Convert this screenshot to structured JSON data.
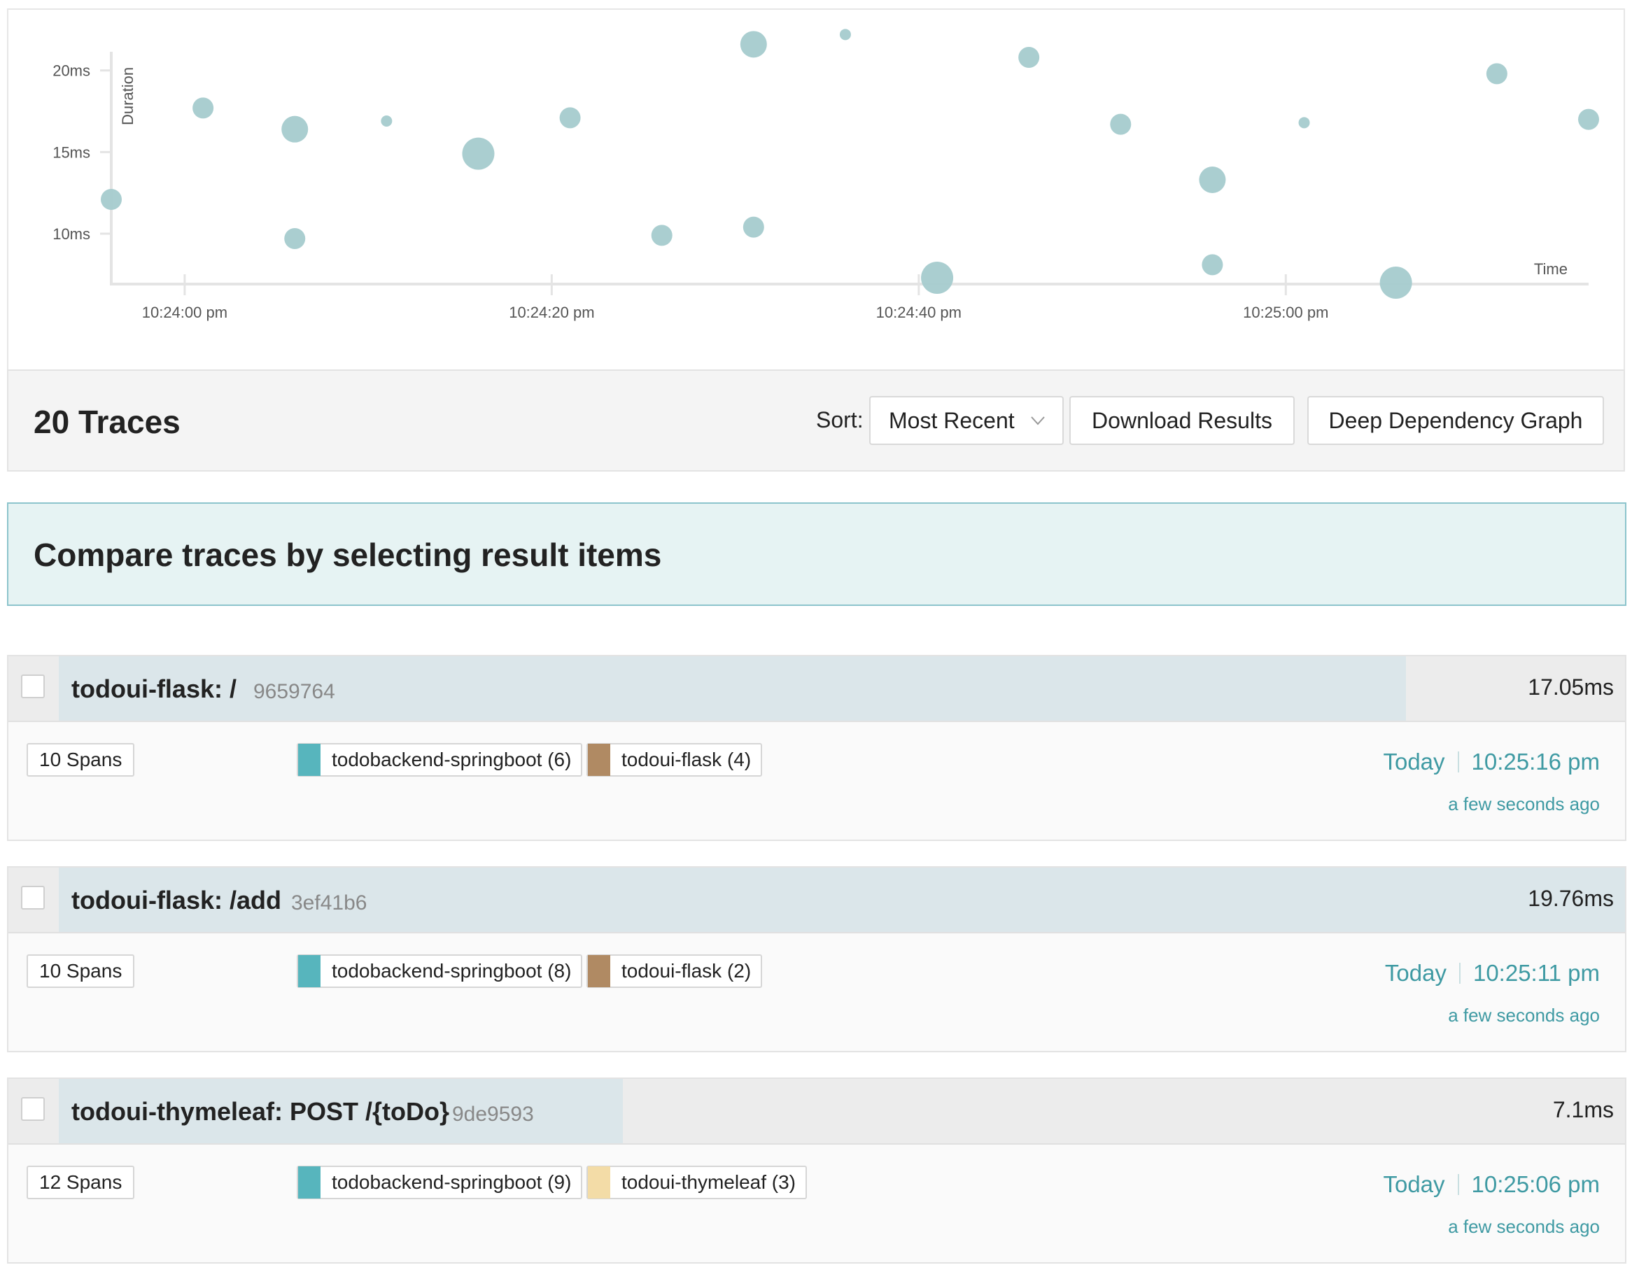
{
  "chart_data": {
    "type": "scatter",
    "xlabel": "Time",
    "ylabel": "Duration",
    "x_tick_labels": [
      "10:24:00 pm",
      "10:24:20 pm",
      "10:24:40 pm",
      "10:25:00 pm"
    ],
    "x_ticks_seconds": [
      0,
      20,
      40,
      60
    ],
    "y_tick_labels": [
      "10ms",
      "15ms",
      "20ms"
    ],
    "y_ticks_ms": [
      10,
      15,
      20
    ],
    "xlim_seconds": [
      -4,
      76.5
    ],
    "ylim_ms": [
      7,
      22
    ],
    "bubble_color": "#a5cbcd",
    "points": [
      {
        "t": -4.0,
        "ms": 12.1,
        "size": 2
      },
      {
        "t": 1.0,
        "ms": 17.7,
        "size": 2
      },
      {
        "t": 6.0,
        "ms": 16.4,
        "size": 3
      },
      {
        "t": 6.0,
        "ms": 9.7,
        "size": 2
      },
      {
        "t": 11.0,
        "ms": 16.9,
        "size": 1
      },
      {
        "t": 16.0,
        "ms": 14.9,
        "size": 4
      },
      {
        "t": 21.0,
        "ms": 17.1,
        "size": 2
      },
      {
        "t": 26.0,
        "ms": 9.9,
        "size": 2
      },
      {
        "t": 31.0,
        "ms": 21.6,
        "size": 3
      },
      {
        "t": 31.0,
        "ms": 10.4,
        "size": 2
      },
      {
        "t": 36.0,
        "ms": 22.2,
        "size": 1
      },
      {
        "t": 41.0,
        "ms": 7.3,
        "size": 4
      },
      {
        "t": 46.0,
        "ms": 20.8,
        "size": 2
      },
      {
        "t": 51.0,
        "ms": 16.7,
        "size": 2
      },
      {
        "t": 56.0,
        "ms": 13.3,
        "size": 3
      },
      {
        "t": 56.0,
        "ms": 8.1,
        "size": 2
      },
      {
        "t": 61.0,
        "ms": 16.8,
        "size": 1
      },
      {
        "t": 66.0,
        "ms": 7.0,
        "size": 4
      },
      {
        "t": 71.5,
        "ms": 19.8,
        "size": 2
      },
      {
        "t": 76.5,
        "ms": 17.0,
        "size": 2
      }
    ]
  },
  "results": {
    "count_label": "20 Traces",
    "sort_label": "Sort:",
    "sort_value": "Most Recent",
    "download_label": "Download Results",
    "ddg_label": "Deep Dependency Graph"
  },
  "compare": {
    "text": "Compare traces by selecting result items"
  },
  "traces": [
    {
      "title": "todoui-flask: /",
      "trace_id": "9659764",
      "duration": "17.05ms",
      "duration_fraction": 0.86,
      "spans": "10 Spans",
      "services": [
        {
          "label": "todobackend-springboot (6)",
          "color": "#57b5bd"
        },
        {
          "label": "todoui-flask (4)",
          "color": "#b08a63"
        }
      ],
      "day": "Today",
      "time": "10:25:16 pm",
      "ago": "a few seconds ago"
    },
    {
      "title": "todoui-flask: /add",
      "trace_id": "3ef41b6",
      "duration": "19.76ms",
      "duration_fraction": 1.0,
      "spans": "10 Spans",
      "services": [
        {
          "label": "todobackend-springboot (8)",
          "color": "#57b5bd"
        },
        {
          "label": "todoui-flask (2)",
          "color": "#b08a63"
        }
      ],
      "day": "Today",
      "time": "10:25:11 pm",
      "ago": "a few seconds ago"
    },
    {
      "title": "todoui-thymeleaf: POST /{toDo}",
      "trace_id": "9de9593",
      "duration": "7.1ms",
      "duration_fraction": 0.36,
      "spans": "12 Spans",
      "services": [
        {
          "label": "todobackend-springboot (9)",
          "color": "#57b5bd"
        },
        {
          "label": "todoui-thymeleaf (3)",
          "color": "#f3dca7"
        }
      ],
      "day": "Today",
      "time": "10:25:06 pm",
      "ago": "a few seconds ago"
    }
  ]
}
